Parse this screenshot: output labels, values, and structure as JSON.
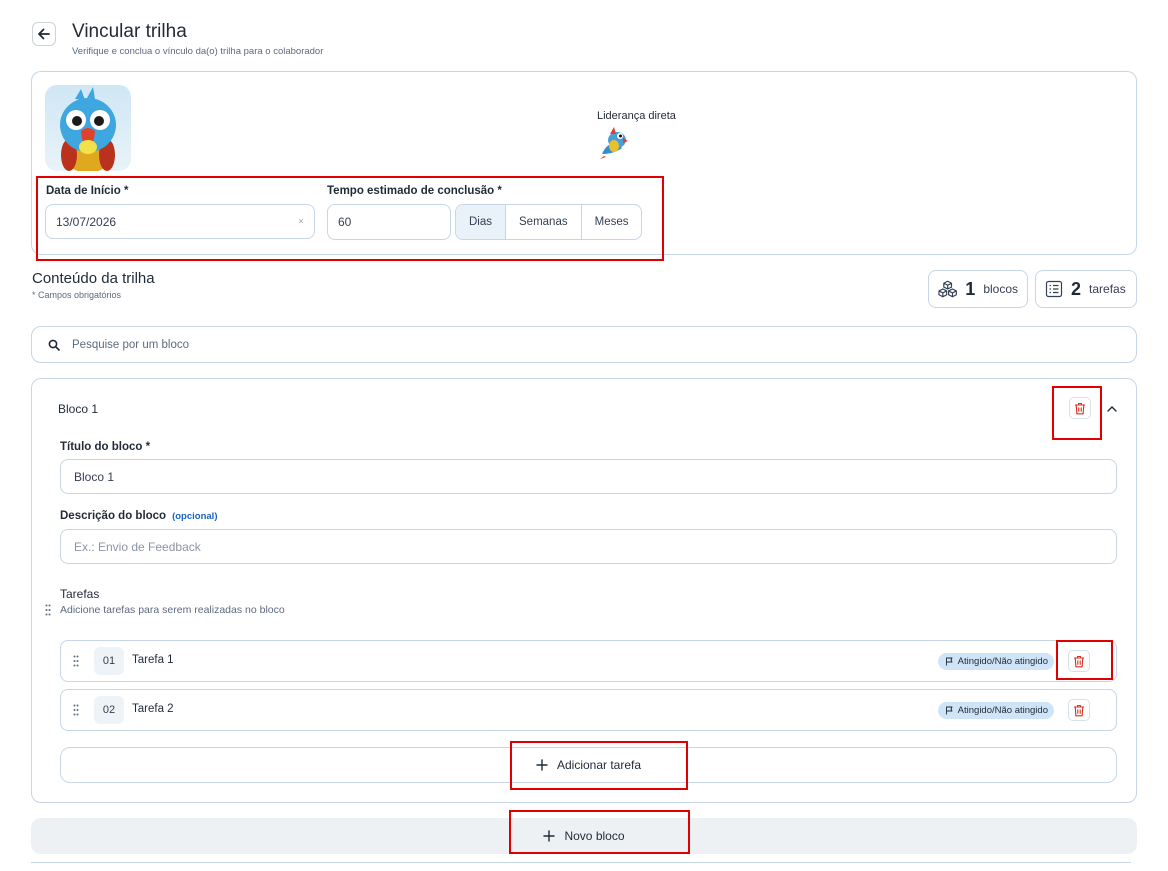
{
  "header": {
    "title": "Vincular trilha",
    "subtitle": "Verifique e conclua o vínculo da(o) trilha para o colaborador"
  },
  "profile": {
    "leadership_label": "Liderança direta"
  },
  "start_date": {
    "label": "Data de Início",
    "required_mark": "*",
    "value": "13/07/2026",
    "clear_glyph": "×"
  },
  "estimated_time": {
    "label": "Tempo estimado de conclusão",
    "required_mark": "*",
    "value": "60",
    "units": [
      "Dias",
      "Semanas",
      "Meses"
    ],
    "selected_unit": "Dias"
  },
  "content": {
    "title": "Conteúdo da trilha",
    "required_note": "* Campos obrigatórios",
    "blocks_count": "1",
    "blocks_label": "blocos",
    "tasks_count": "2",
    "tasks_label": "tarefas"
  },
  "search": {
    "placeholder": "Pesquise por um bloco"
  },
  "block": {
    "header_title": "Bloco 1",
    "title_label": "Título do bloco",
    "required_mark": "*",
    "title_value": "Bloco 1",
    "description_label": "Descrição do bloco",
    "optional_label": "(opcional)",
    "description_placeholder": "Ex.: Envio de Feedback",
    "tasks_title": "Tarefas",
    "tasks_subtitle": "Adicione tarefas para serem realizadas no bloco",
    "tasks": [
      {
        "number": "01",
        "name": "Tarefa 1",
        "badge": "Atingido/Não atingido"
      },
      {
        "number": "02",
        "name": "Tarefa 2",
        "badge": "Atingido/Não atingido"
      }
    ],
    "add_task_label": "Adicionar tarefa"
  },
  "new_block_label": "Novo bloco",
  "colors": {
    "highlight_box": "#e00000",
    "border": "#c6d6e6",
    "trash_red": "#d92d20",
    "badge_bg": "#cfe4f7",
    "optional_link": "#1a63c4"
  }
}
